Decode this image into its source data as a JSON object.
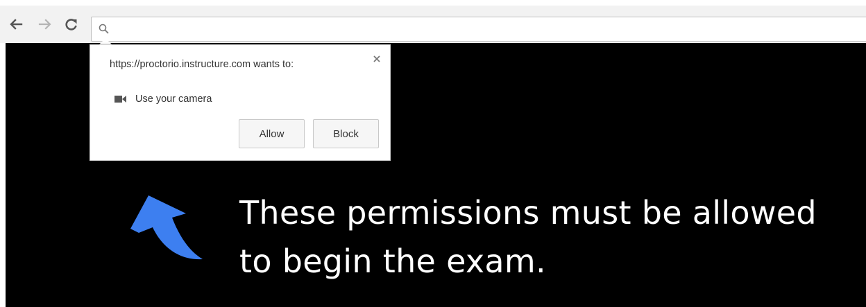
{
  "browser": {
    "omnibox": {
      "value": "",
      "placeholder": ""
    },
    "icons": {
      "back": "arrow-left-icon",
      "forward": "arrow-right-icon",
      "reload": "reload-icon",
      "search": "search-icon"
    }
  },
  "permission_prompt": {
    "title": "https://proctorio.instructure.com wants to:",
    "permission_label": "Use your camera",
    "allow_label": "Allow",
    "block_label": "Block",
    "icons": {
      "close": "close-icon",
      "camera": "camera-icon"
    }
  },
  "page": {
    "message_line1": "These permissions must be allowed",
    "message_line2": "to begin the exam.",
    "arrow_color": "#3d7ff0",
    "background_color": "#000000"
  }
}
